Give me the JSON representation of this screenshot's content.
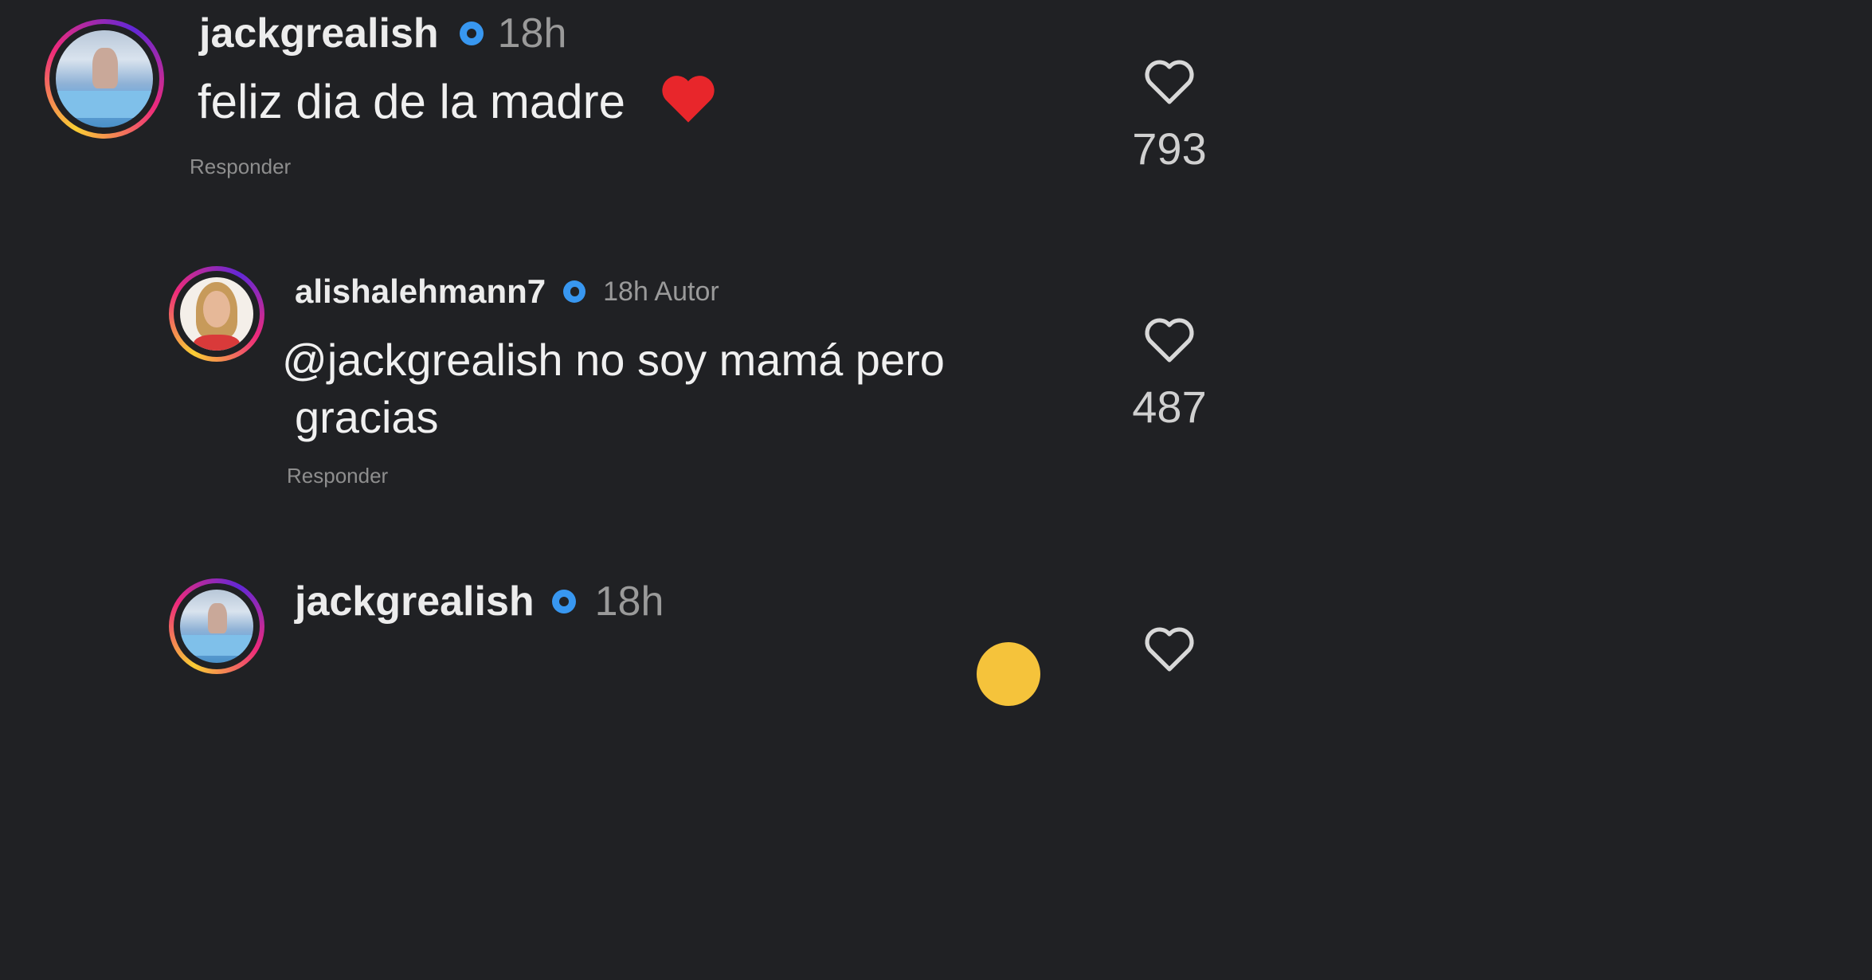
{
  "comments": [
    {
      "username": "jackgrealish",
      "time": "18h",
      "text": "feliz dia de la madre",
      "emoji": "❤️",
      "reply_label": "Responder",
      "likes": "793"
    },
    {
      "username": "alishalehmann7",
      "time": "18h Autor",
      "text_line1": "@jackgrealish no soy mamá pero",
      "text_line2": "gracias",
      "reply_label": "Responder",
      "likes": "487"
    },
    {
      "username": "jackgrealish",
      "time": "18h"
    }
  ],
  "icons": {
    "verified": "verified-badge-icon",
    "like": "heart-outline-icon",
    "emoji_heart": "red-heart-emoji-icon",
    "emoji_face": "face-emoji-icon"
  },
  "colors": {
    "background": "#202124",
    "verified_blue": "#3897f0",
    "heart_red": "#e8262b",
    "muted_text": "#9a9a9a"
  }
}
